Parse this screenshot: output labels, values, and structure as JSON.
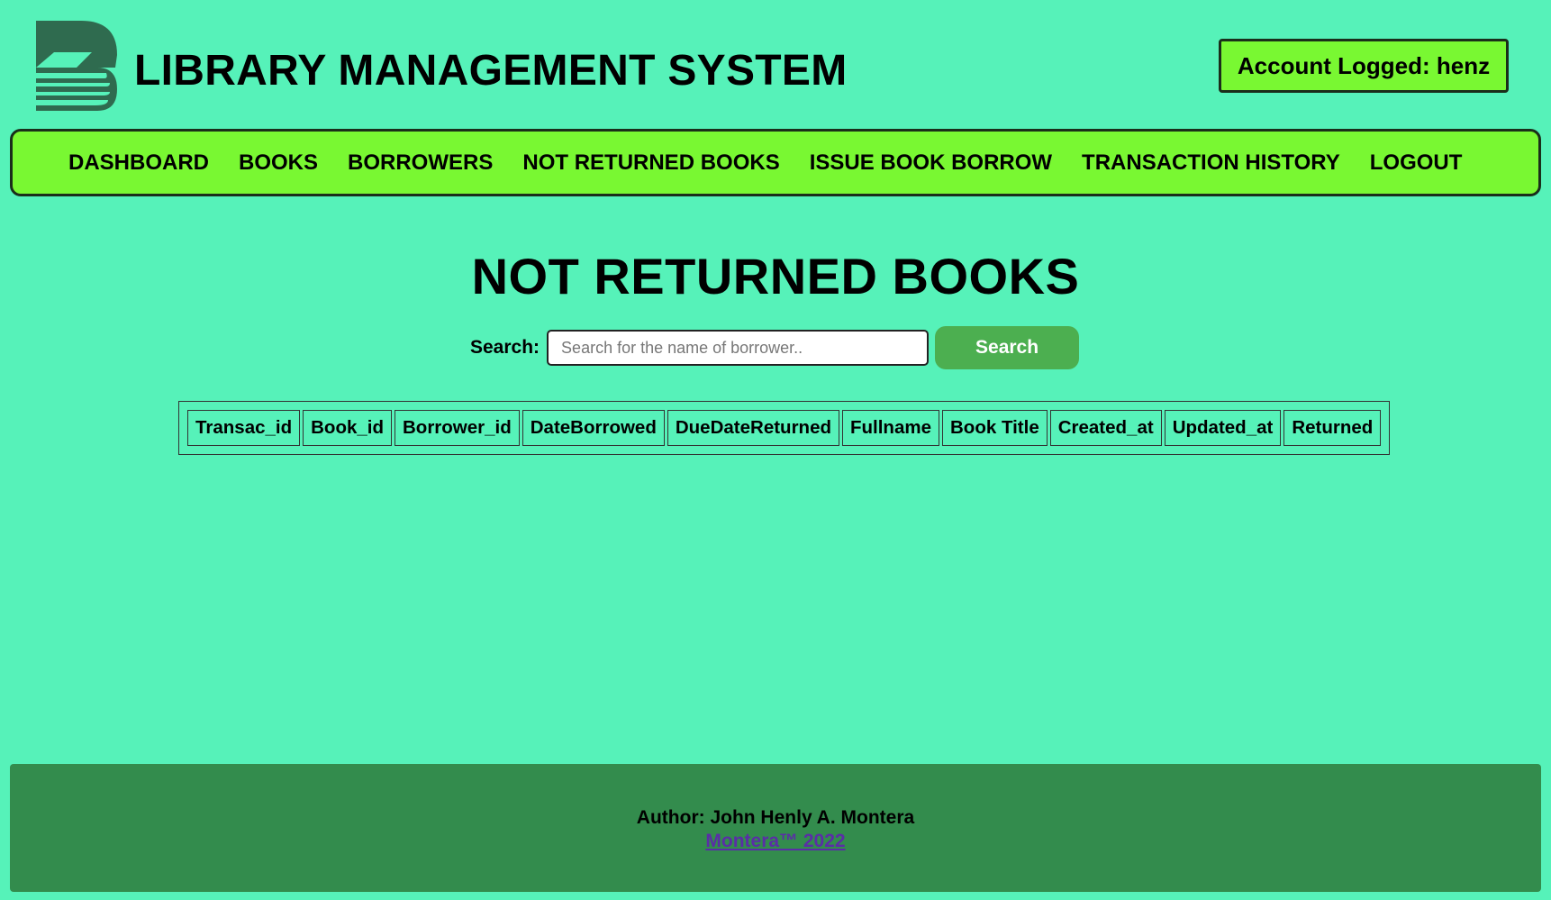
{
  "header": {
    "title": "LIBRARY MANAGEMENT SYSTEM",
    "account_label": "Account Logged: henz",
    "logo_icon": "book-stack-logo-icon"
  },
  "nav": {
    "items": [
      {
        "label": "DASHBOARD"
      },
      {
        "label": "BOOKS"
      },
      {
        "label": "BORROWERS"
      },
      {
        "label": "NOT RETURNED BOOKS"
      },
      {
        "label": "ISSUE BOOK BORROW"
      },
      {
        "label": "TRANSACTION HISTORY"
      },
      {
        "label": "LOGOUT"
      }
    ]
  },
  "main": {
    "page_title": "NOT RETURNED BOOKS",
    "search": {
      "label": "Search:",
      "value": "",
      "placeholder": "Search for the name of borrower..",
      "button_label": "Search"
    },
    "table": {
      "columns": [
        "Transac_id",
        "Book_id",
        "Borrower_id",
        "DateBorrowed",
        "DueDateReturned",
        "Fullname",
        "Book Title",
        "Created_at",
        "Updated_at",
        "Returned"
      ],
      "rows": []
    }
  },
  "footer": {
    "author": "Author: John Henly A. Montera",
    "link_text": "Montera™ 2022"
  },
  "colors": {
    "page_background": "#56f2b9",
    "nav_background": "#79f832",
    "search_button": "#4caf50",
    "footer_background": "#338c4d",
    "logo": "#2f6b4f",
    "footer_link": "#5a2ea6"
  }
}
